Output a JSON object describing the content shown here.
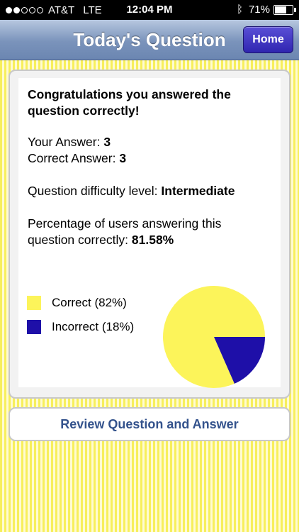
{
  "status_bar": {
    "carrier": "AT&T",
    "network": "LTE",
    "time": "12:04 PM",
    "battery": "71%",
    "battery_level": 0.71,
    "signal_bars": 2,
    "signal_total": 5
  },
  "nav": {
    "title": "Today's Question",
    "home_label": "Home"
  },
  "result": {
    "message": "Congratulations you answered the question correctly!",
    "your_answer_label": "Your Answer:",
    "your_answer": "3",
    "correct_answer_label": "Correct Answer:",
    "correct_answer": "3",
    "difficulty_label": "Question difficulty level:",
    "difficulty": "Intermediate",
    "percentage_label": "Percentage of users answering this question correctly:",
    "percentage": "81.58%"
  },
  "chart_data": {
    "type": "pie",
    "slices": [
      {
        "label": "Correct (82%)",
        "value": 81.58,
        "color": "#fcf45a"
      },
      {
        "label": "Incorrect (18%)",
        "value": 18.42,
        "color": "#1e0fa8"
      }
    ]
  },
  "review_button": "Review Question and Answer",
  "colors": {
    "nav_button": "#3a2fc4",
    "review_text": "#33528c",
    "stripe_light": "#fffbd2",
    "stripe_dark": "#f7ef5c"
  }
}
